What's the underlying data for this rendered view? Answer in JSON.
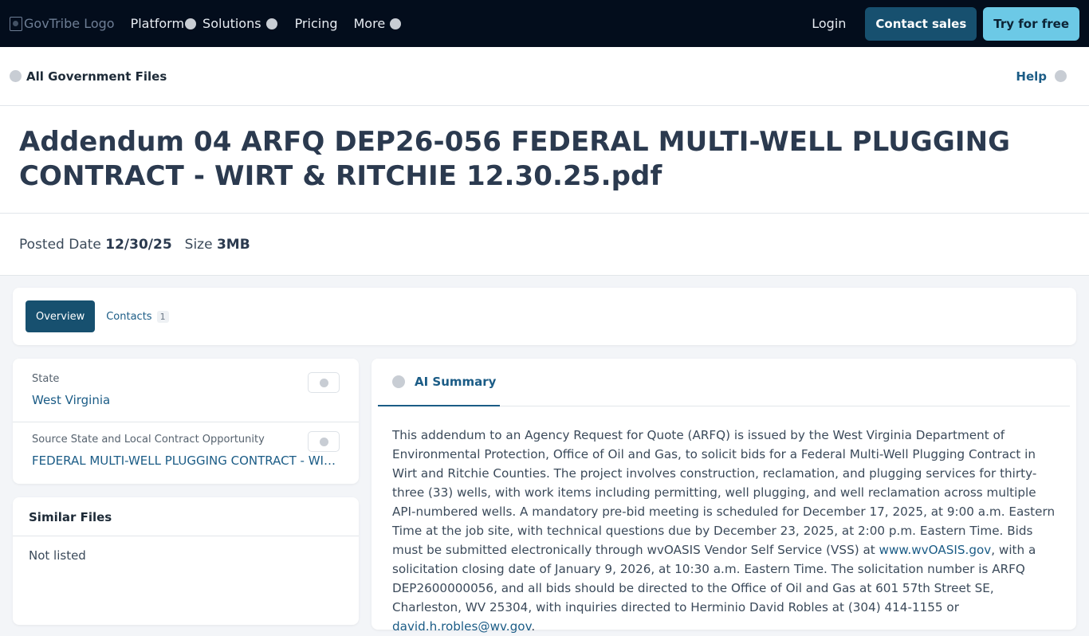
{
  "nav": {
    "logo_alt": "GovTribe Logo",
    "items": [
      "Platform",
      "Solutions",
      "Pricing",
      "More"
    ],
    "login": "Login",
    "contact_sales": "Contact sales",
    "try_free": "Try for free"
  },
  "breadcrumb": {
    "label": "All Government Files",
    "help": "Help"
  },
  "file": {
    "title": "Addendum 04 ARFQ DEP26-056 FEDERAL MULTI-WELL PLUGGING CONTRACT - WIRT & RITCHIE 12.30.25.pdf",
    "posted_label": "Posted Date",
    "posted_value": "12/30/25",
    "size_label": "Size",
    "size_value": "3MB"
  },
  "tabs": {
    "overview": "Overview",
    "contacts": "Contacts",
    "contacts_count": "1"
  },
  "details": {
    "state_label": "State",
    "state_value": "West Virginia",
    "source_label": "Source State and Local Contract Opportunity",
    "source_value": "FEDERAL MULTI-WELL PLUGGING CONTRACT - WIRT & RITCHIE"
  },
  "similar": {
    "heading": "Similar Files",
    "empty": "Not listed"
  },
  "ai_summary": {
    "tab_label": "AI Summary",
    "text_1": "This addendum to an Agency Request for Quote (ARFQ) is issued by the West Virginia Department of Environmental Protection, Office of Oil and Gas, to solicit bids for a Federal Multi-Well Plugging Contract in Wirt and Ritchie Counties. The project involves construction, reclamation, and plugging services for thirty-three (33) wells, with work items including permitting, well plugging, and well reclamation across multiple API-numbered wells. A mandatory pre-bid meeting is scheduled for December 17, 2025, at 9:00 a.m. Eastern Time at the job site, with technical questions due by December 23, 2025, at 2:00 p.m. Eastern Time. Bids must be submitted electronically through wvOASIS Vendor Self Service (VSS) at ",
    "link_1": "www.wvOASIS.gov",
    "text_2": ", with a solicitation closing date of January 9, 2026, at 10:30 a.m. Eastern Time. The solicitation number is ARFQ DEP2600000056, and all bids should be directed to the Office of Oil and Gas at 601 57th Street SE, Charleston, WV 25304, with inquiries directed to Herminio David Robles at (304) 414-1155 or ",
    "link_2": "david.h.robles@wv.gov",
    "text_3": "."
  }
}
